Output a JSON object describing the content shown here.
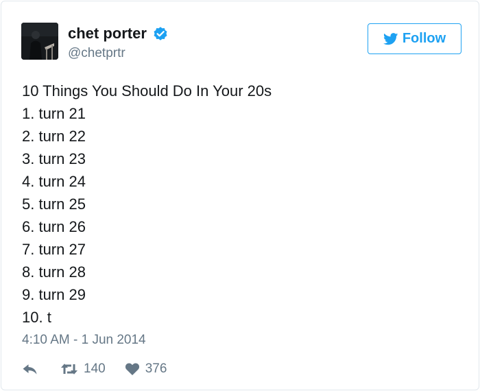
{
  "user": {
    "name": "chet porter",
    "handle": "@chetprtr",
    "verified": true,
    "avatar_icon": "user-avatar"
  },
  "follow_button": {
    "label": "Follow",
    "icon": "twitter-bird-icon"
  },
  "tweet": {
    "lines": [
      "10 Things You Should Do In Your 20s",
      "1. turn 21",
      "2. turn 22",
      "3. turn 23",
      "4. turn 24",
      "5. turn 25",
      "6. turn 26",
      "7. turn 27",
      "8. turn 28",
      "9. turn 29",
      "10. t"
    ],
    "timestamp": "4:10 AM - 1 Jun 2014"
  },
  "actions": {
    "reply_icon": "reply-icon",
    "retweet_icon": "retweet-icon",
    "retweet_count": "140",
    "like_icon": "heart-icon",
    "like_count": "376"
  },
  "colors": {
    "accent": "#1da1f2",
    "verified": "#1da1f2",
    "text": "#14171a",
    "muted": "#657786",
    "border": "#e1e8ed"
  }
}
